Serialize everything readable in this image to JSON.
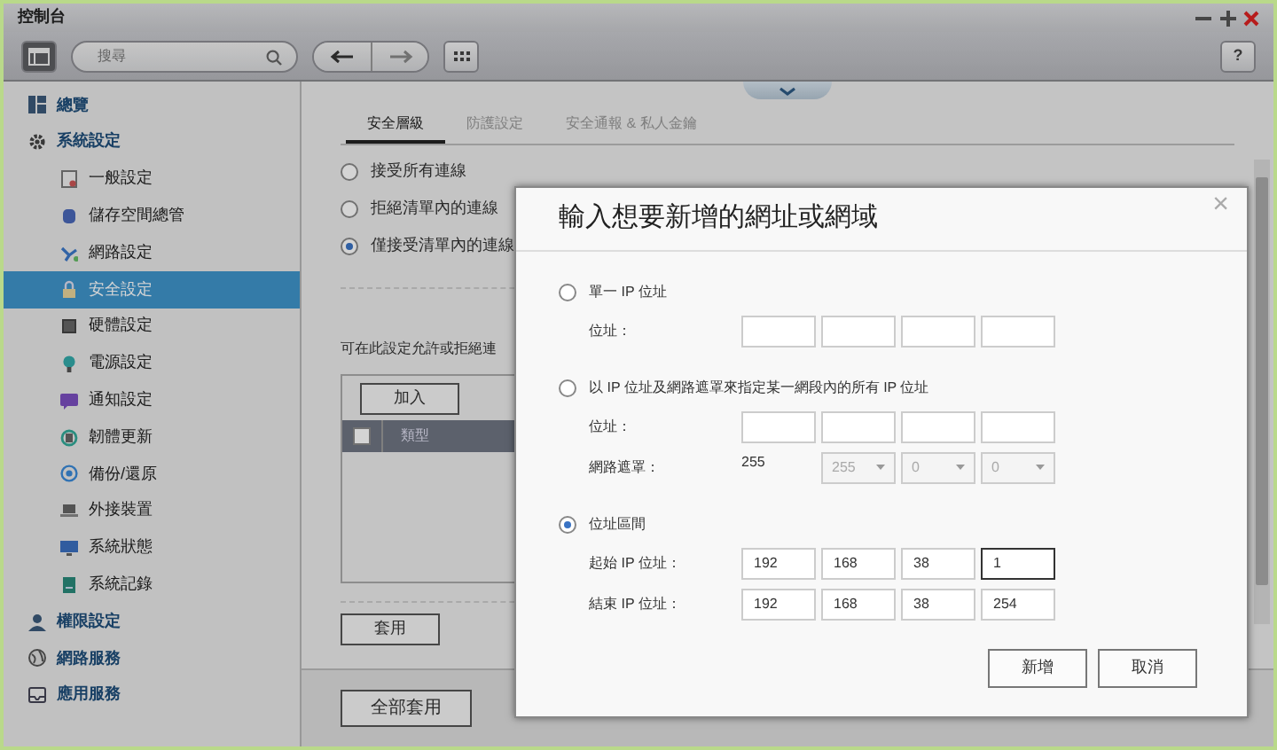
{
  "window": {
    "title": "控制台"
  },
  "toolbar": {
    "search": {
      "placeholder": "搜尋"
    },
    "help": "?"
  },
  "sidebar": {
    "items": [
      {
        "label": "總覽",
        "selected": false
      },
      {
        "label": "系統設定",
        "selected": false,
        "children": [
          {
            "label": "一般設定",
            "selected": false
          },
          {
            "label": "儲存空間總管",
            "selected": false
          },
          {
            "label": "網路設定",
            "selected": false
          },
          {
            "label": "安全設定",
            "selected": true
          },
          {
            "label": "硬體設定",
            "selected": false
          },
          {
            "label": "電源設定",
            "selected": false
          },
          {
            "label": "通知設定",
            "selected": false
          },
          {
            "label": "韌體更新",
            "selected": false
          },
          {
            "label": "備份/還原",
            "selected": false
          },
          {
            "label": "外接裝置",
            "selected": false
          },
          {
            "label": "系統狀態",
            "selected": false
          },
          {
            "label": "系統記錄",
            "selected": false
          }
        ]
      },
      {
        "label": "權限設定",
        "selected": false
      },
      {
        "label": "網路服務",
        "selected": false
      },
      {
        "label": "應用服務",
        "selected": false
      }
    ]
  },
  "tabs": [
    {
      "label": "安全層級",
      "selected": true
    },
    {
      "label": "防護設定",
      "selected": false
    },
    {
      "label": "安全通報 & 私人金鑰",
      "selected": false
    }
  ],
  "access_options": [
    {
      "label": "接受所有連線",
      "selected": false
    },
    {
      "label": "拒絕清單內的連線",
      "selected": false
    },
    {
      "label": "僅接受清單內的連線",
      "selected": true
    }
  ],
  "list": {
    "description": "可在此設定允許或拒絕連",
    "add_button": "加入",
    "header_checked": false,
    "columns": [
      "類型"
    ]
  },
  "apply_button": "套用",
  "apply_all_button": "全部套用",
  "dialog": {
    "title": "輸入想要新增的網址或網域",
    "close": "×",
    "options": [
      {
        "label": "單一 IP 位址",
        "selected": false,
        "fields": [
          {
            "kind": "ip",
            "label": "位址："
          }
        ]
      },
      {
        "label": "以 IP 位址及網路遮罩來指定某一網段內的所有 IP 位址",
        "selected": false,
        "fields": [
          {
            "kind": "ip",
            "label": "位址："
          },
          {
            "kind": "mask",
            "label": "網路遮罩：",
            "fixed": "255",
            "disabled": true,
            "selects": [
              "255",
              "0",
              "0"
            ]
          }
        ]
      },
      {
        "label": "位址區間",
        "selected": true,
        "fields": [
          {
            "kind": "ip",
            "label": "起始 IP 位址：",
            "octets": [
              {
                "value": "192",
                "focused": false
              },
              {
                "value": "168",
                "focused": false
              },
              {
                "value": "38",
                "focused": false
              },
              {
                "value": "1",
                "focused": true
              }
            ]
          },
          {
            "kind": "ip",
            "label": "結束 IP 位址：",
            "octets": [
              {
                "value": "192",
                "focused": false
              },
              {
                "value": "168",
                "focused": false
              },
              {
                "value": "38",
                "focused": false
              },
              {
                "value": "254",
                "focused": false
              }
            ]
          }
        ]
      }
    ],
    "buttons": [
      "新增",
      "取消"
    ]
  }
}
